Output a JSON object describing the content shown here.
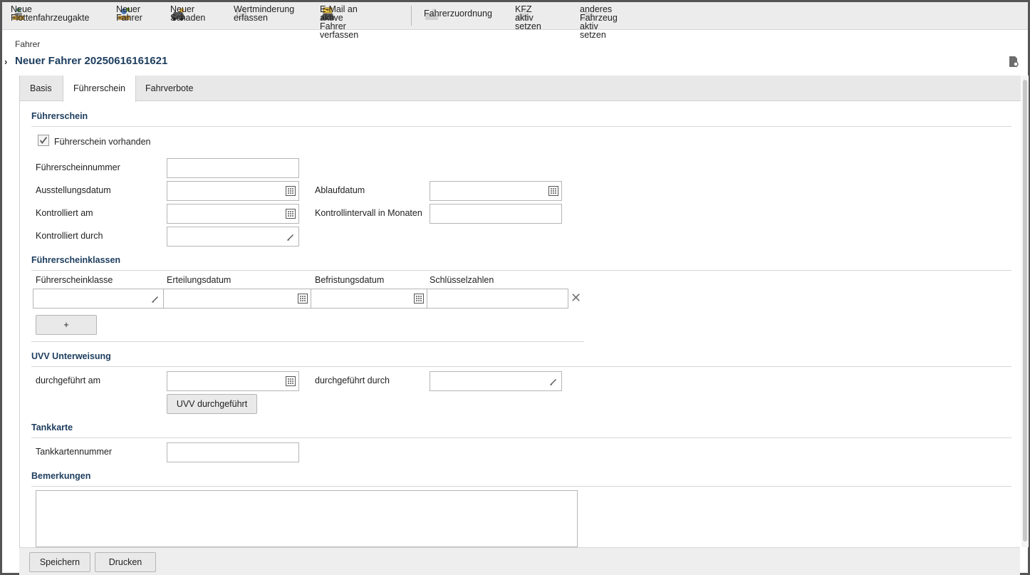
{
  "toolbar": {
    "new_fleet_file": [
      "Neue",
      "Flottenfahrzeugakte"
    ],
    "new_driver": [
      "Neuer",
      "Fahrer"
    ],
    "new_damage": [
      "Neuer",
      "Schaden"
    ],
    "depreciation": [
      "Wertminderung",
      "erfassen"
    ],
    "email_drivers": [
      "E-Mail an aktive",
      "Fahrer verfassen"
    ],
    "driver_assignment": "Fahrerzuordnung",
    "vehicle_active": [
      "KFZ aktiv",
      "setzen"
    ],
    "other_vehicle_active": [
      "anderes Fahrzeug",
      "aktiv setzen"
    ]
  },
  "header": {
    "breadcrumb": "Fahrer",
    "title": "Neuer Fahrer 20250616161621"
  },
  "tabs": [
    "Basis",
    "Führerschein",
    "Fahrverbote"
  ],
  "active_tab": "Führerschein",
  "license": {
    "section": "Führerschein",
    "has_license_label": "Führerschein vorhanden",
    "has_license_checked": true,
    "number_label": "Führerscheinnummer",
    "issue_date_label": "Ausstellungsdatum",
    "expiry_date_label": "Ablaufdatum",
    "checked_on_label": "Kontrolliert am",
    "interval_label": "Kontrollintervall in Monaten",
    "checked_by_label": "Kontrolliert durch"
  },
  "classes": {
    "section": "Führerscheinklassen",
    "columns": [
      "Führerscheinklasse",
      "Erteilungsdatum",
      "Befristungsdatum",
      "Schlüsselzahlen"
    ],
    "add_label": "+"
  },
  "uvv": {
    "section": "UVV Unterweisung",
    "done_on_label": "durchgeführt am",
    "done_by_label": "durchgeführt durch",
    "button": "UVV durchgeführt"
  },
  "fuel_card": {
    "section": "Tankkarte",
    "number_label": "Tankkartennummer"
  },
  "remarks": {
    "section": "Bemerkungen"
  },
  "footer": {
    "save": "Speichern",
    "print": "Drucken"
  },
  "colors": {
    "accent": "#1c3d5e",
    "toolbar_bg": "#ececec",
    "disabled": "#a9a9a9"
  }
}
